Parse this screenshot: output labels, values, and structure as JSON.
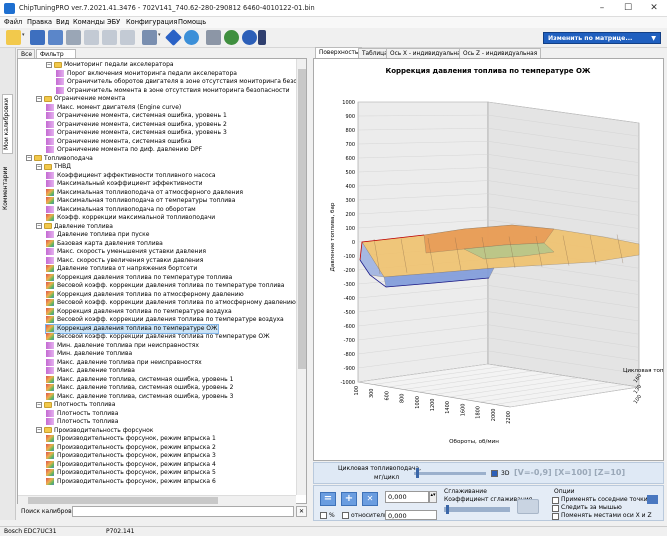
{
  "window": {
    "title": "ChipTuningPRO ver.7.2021.41.3476 - 702V141_740.62-280-290812 6460-4010122-01.bin"
  },
  "menu": [
    "Файл",
    "Правка",
    "Вид",
    "Команды",
    "ЭБУ",
    "Конфигурация",
    "Помощь"
  ],
  "toolbar": {
    "matrix_button": "Изменить по матрице...",
    "matrix_arrow": "▼"
  },
  "left_tabs": [
    "Мои калибровки",
    "Комментарии"
  ],
  "tree_tabs": [
    "Все",
    "Фильтр"
  ],
  "tree": [
    {
      "level": 2,
      "icon": "folder",
      "label": "Мониторинг педали акселератора"
    },
    {
      "level": 3,
      "icon": "map-flat",
      "label": "Порог включения мониторинга педали акселератора"
    },
    {
      "level": 3,
      "icon": "map-flat",
      "label": "Ограничитель оборотов двигателя в зоне отсутствия мониторинга безопасности"
    },
    {
      "level": 3,
      "icon": "map-flat",
      "label": "Ограничитель момента в зоне отсутствия мониторинга безопасности"
    },
    {
      "level": 1,
      "icon": "folder",
      "label": "Ограничение момента"
    },
    {
      "level": 2,
      "icon": "map-flat",
      "label": "Макс. момент двигателя (Engine curve)"
    },
    {
      "level": 2,
      "icon": "map-flat",
      "label": "Ограничение момента, системная ошибка, уровень 1"
    },
    {
      "level": 2,
      "icon": "map-flat",
      "label": "Ограничение момента, системная ошибка, уровень 2"
    },
    {
      "level": 2,
      "icon": "map-flat",
      "label": "Ограничение момента, системная ошибка, уровень 3"
    },
    {
      "level": 2,
      "icon": "map-flat",
      "label": "Ограничение момента, системная ошибка"
    },
    {
      "level": 2,
      "icon": "map-flat",
      "label": "Ограничение момента по диф. давлению DPF"
    },
    {
      "level": 0,
      "icon": "folder",
      "label": "Топливоподача"
    },
    {
      "level": 1,
      "icon": "folder",
      "label": "ТНВД"
    },
    {
      "level": 2,
      "icon": "map-flat",
      "label": "Коэффициент эффективности топливного насоса"
    },
    {
      "level": 2,
      "icon": "map-flat",
      "label": "Максимальный коэффициент эффективности"
    },
    {
      "level": 2,
      "icon": "map",
      "label": "Максимальная топливоподача от атмосферного давления"
    },
    {
      "level": 2,
      "icon": "map",
      "label": "Максимальная топливоподача от температуры топлива"
    },
    {
      "level": 2,
      "icon": "map-flat",
      "label": "Максимальная топливоподача по оборотам"
    },
    {
      "level": 2,
      "icon": "map",
      "label": "Коэфф. коррекции максимальной топливоподачи"
    },
    {
      "level": 1,
      "icon": "folder",
      "label": "Давление топлива"
    },
    {
      "level": 2,
      "icon": "map-flat",
      "label": "Давление топлива при пуске"
    },
    {
      "level": 2,
      "icon": "map",
      "label": "Базовая карта давления топлива"
    },
    {
      "level": 2,
      "icon": "map-flat",
      "label": "Макс. скорость уменьшения уставки давления"
    },
    {
      "level": 2,
      "icon": "map-flat",
      "label": "Макс. скорость увеличения уставки давления"
    },
    {
      "level": 2,
      "icon": "map",
      "label": "Давление топлива от напряжения бортсети"
    },
    {
      "level": 2,
      "icon": "map",
      "label": "Коррекция давления топлива по температуре топлива"
    },
    {
      "level": 2,
      "icon": "map",
      "label": "Весовой коэфф. коррекции давления топлива по температуре топлива"
    },
    {
      "level": 2,
      "icon": "map",
      "label": "Коррекция давления топлива по атмосферному давлению"
    },
    {
      "level": 2,
      "icon": "map",
      "label": "Весовой коэфф. коррекции давления топлива по атмосферному давлению"
    },
    {
      "level": 2,
      "icon": "map",
      "label": "Коррекция давления топлива по температуре воздуха"
    },
    {
      "level": 2,
      "icon": "map",
      "label": "Весовой коэфф. коррекции давления топлива по температуре воздуха"
    },
    {
      "level": 2,
      "icon": "map",
      "label": "Коррекция давления топлива по температуре ОЖ",
      "selected": true
    },
    {
      "level": 2,
      "icon": "map",
      "label": "Весовой коэфф. коррекции давления топлива по температуре ОЖ"
    },
    {
      "level": 2,
      "icon": "map-flat",
      "label": "Мин. давление топлива при неисправностях"
    },
    {
      "level": 2,
      "icon": "map-flat",
      "label": "Мин. давление топлива"
    },
    {
      "level": 2,
      "icon": "map-flat",
      "label": "Макс. давление топлива при неисправностях"
    },
    {
      "level": 2,
      "icon": "map-flat",
      "label": "Макс. давление топлива"
    },
    {
      "level": 2,
      "icon": "map",
      "label": "Макс. давление топлива, системная ошибка, уровень 1"
    },
    {
      "level": 2,
      "icon": "map",
      "label": "Макс. давление топлива, системная ошибка, уровень 2"
    },
    {
      "level": 2,
      "icon": "map",
      "label": "Макс. давление топлива, системная ошибка, уровень 3"
    },
    {
      "level": 1,
      "icon": "folder",
      "label": "Плотность топлива"
    },
    {
      "level": 2,
      "icon": "map-flat",
      "label": "Плотность топлива"
    },
    {
      "level": 2,
      "icon": "map-flat",
      "label": "Плотность топлива"
    },
    {
      "level": 1,
      "icon": "folder",
      "label": "Производительность форсунок"
    },
    {
      "level": 2,
      "icon": "map",
      "label": "Производительность форсунок, режим впрыска 1"
    },
    {
      "level": 2,
      "icon": "map",
      "label": "Производительность форсунок, режим впрыска 2"
    },
    {
      "level": 2,
      "icon": "map",
      "label": "Производительность форсунок, режим впрыска 3"
    },
    {
      "level": 2,
      "icon": "map",
      "label": "Производительность форсунок, режим впрыска 4"
    },
    {
      "level": 2,
      "icon": "map",
      "label": "Производительность форсунок, режим впрыска 5"
    },
    {
      "level": 2,
      "icon": "map",
      "label": "Производительность форсунок, режим впрыска 6"
    }
  ],
  "search": {
    "label": "Поиск калибровки",
    "value": ""
  },
  "right_tabs": [
    "Поверхность",
    "Таблица",
    "Ось X - индивидуальная",
    "Ось Z - индивидуальная"
  ],
  "chart_data": {
    "type": "surface3d",
    "title": "Коррекция давления топлива по температуре ОЖ",
    "ylabel": "Давление топлива, бар",
    "xlabel": "Обороты, об/мин",
    "zlabel": "Цикловая топ",
    "y_ticks": [
      1000,
      900,
      800,
      700,
      600,
      500,
      400,
      300,
      200,
      100,
      0,
      -100,
      -200,
      -300,
      -400,
      -500,
      -600,
      -700,
      -800,
      -900,
      -1000
    ],
    "x_ticks": [
      100,
      300,
      600,
      800,
      1000,
      1200,
      1400,
      1600,
      1800,
      2000,
      2200
    ],
    "z_ticks": [
      160,
      130,
      100
    ]
  },
  "controls": {
    "slider_label_line1": "Цикловая топливоподача,",
    "slider_label_line2": "мг/цикл",
    "check_3d": "3D",
    "readout": "[V=-0,9] [X=100] [Z=10]",
    "value1": "0,000",
    "value2": "0,000",
    "percent": "%",
    "relative": "относительно",
    "smoothing_title": "Сглаживание",
    "smoothing_coef": "Коэффициент сглаживания",
    "options_title": "Опции",
    "opt1": "Применять соседние точки",
    "opt2": "Следить за мышью",
    "opt3": "Поменять местами оси X и Z"
  },
  "status": {
    "ecu": "Bosch EDC7UC31",
    "part": "P702.141"
  },
  "colors": {
    "accent": "#1f5fbf",
    "surface_high": "#e8a060",
    "surface_low": "#6c8ccf",
    "selection": "#cce4f7"
  }
}
